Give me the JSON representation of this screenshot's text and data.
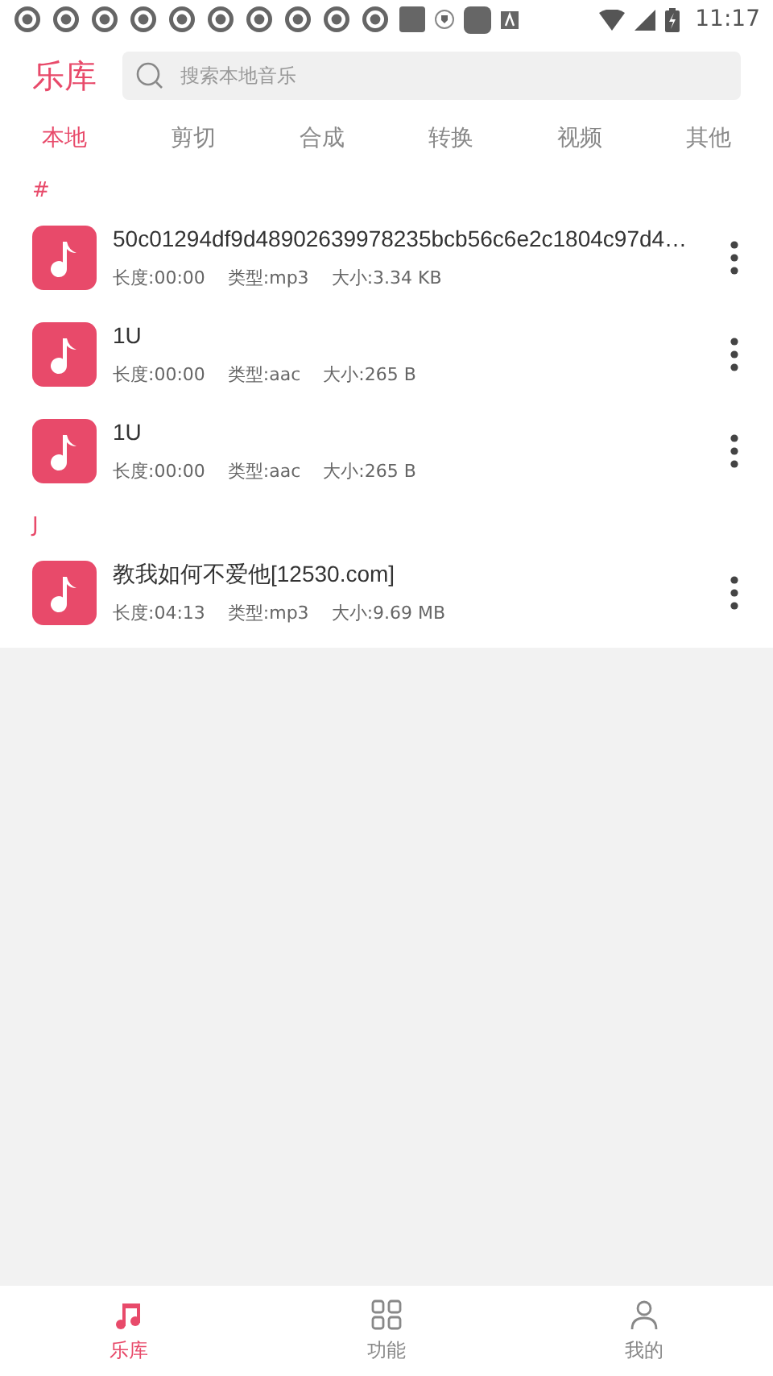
{
  "status_bar": {
    "time": "11:17"
  },
  "header": {
    "title": "乐库",
    "search": {
      "placeholder": "搜索本地音乐"
    }
  },
  "tabs": [
    {
      "label": "本地",
      "selected": true
    },
    {
      "label": "剪切",
      "selected": false
    },
    {
      "label": "合成",
      "selected": false
    },
    {
      "label": "转换",
      "selected": false
    },
    {
      "label": "视频",
      "selected": false
    },
    {
      "label": "其他",
      "selected": false
    }
  ],
  "sections": [
    {
      "letter": "#",
      "songs": [
        {
          "title": "50c01294df9d48902639978235bcb56c6e2c1804c97d4…",
          "length": "长度:00:00",
          "type": "类型:mp3",
          "size": "大小:3.34 KB"
        },
        {
          "title": "1U",
          "length": "长度:00:00",
          "type": "类型:aac",
          "size": "大小:265 B"
        },
        {
          "title": "1U",
          "length": "长度:00:00",
          "type": "类型:aac",
          "size": "大小:265 B"
        }
      ]
    },
    {
      "letter": "J",
      "songs": [
        {
          "title": "教我如何不爱他[12530.com]",
          "length": "长度:04:13",
          "type": "类型:mp3",
          "size": "大小:9.69 MB"
        }
      ]
    }
  ],
  "bottom_nav": [
    {
      "kind": "music",
      "label": "乐库",
      "selected": true
    },
    {
      "kind": "grid",
      "label": "功能",
      "selected": false
    },
    {
      "kind": "person",
      "label": "我的",
      "selected": false
    }
  ]
}
